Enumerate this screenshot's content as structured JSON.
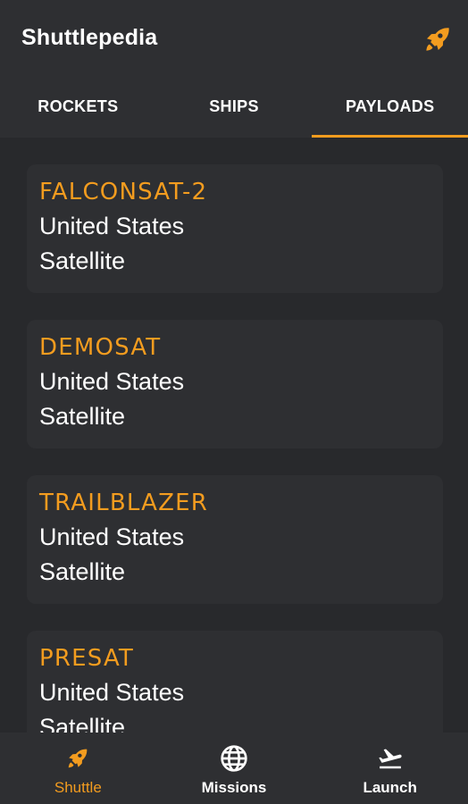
{
  "app": {
    "title": "Shuttlepedia"
  },
  "colors": {
    "accent": "#f39c1f",
    "background": "#28292c",
    "surface": "#2e2f32"
  },
  "header": {
    "action_icon": "rocket-icon"
  },
  "tabs": [
    {
      "label": "ROCKETS",
      "active": false
    },
    {
      "label": "SHIPS",
      "active": false
    },
    {
      "label": "PAYLOADS",
      "active": true
    }
  ],
  "payloads": [
    {
      "name": "FALCONSAT-2",
      "nationality": "United States",
      "type": "Satellite"
    },
    {
      "name": "DEMOSAT",
      "nationality": "United States",
      "type": "Satellite"
    },
    {
      "name": "TRAILBLAZER",
      "nationality": "United States",
      "type": "Satellite"
    },
    {
      "name": "PRESAT",
      "nationality": "United States",
      "type": "Satellite"
    }
  ],
  "bottom_nav": [
    {
      "label": "Shuttle",
      "icon": "rocket-icon",
      "active": true
    },
    {
      "label": "Missions",
      "icon": "globe-icon",
      "active": false
    },
    {
      "label": "Launch",
      "icon": "airplane-takeoff-icon",
      "active": false
    }
  ]
}
